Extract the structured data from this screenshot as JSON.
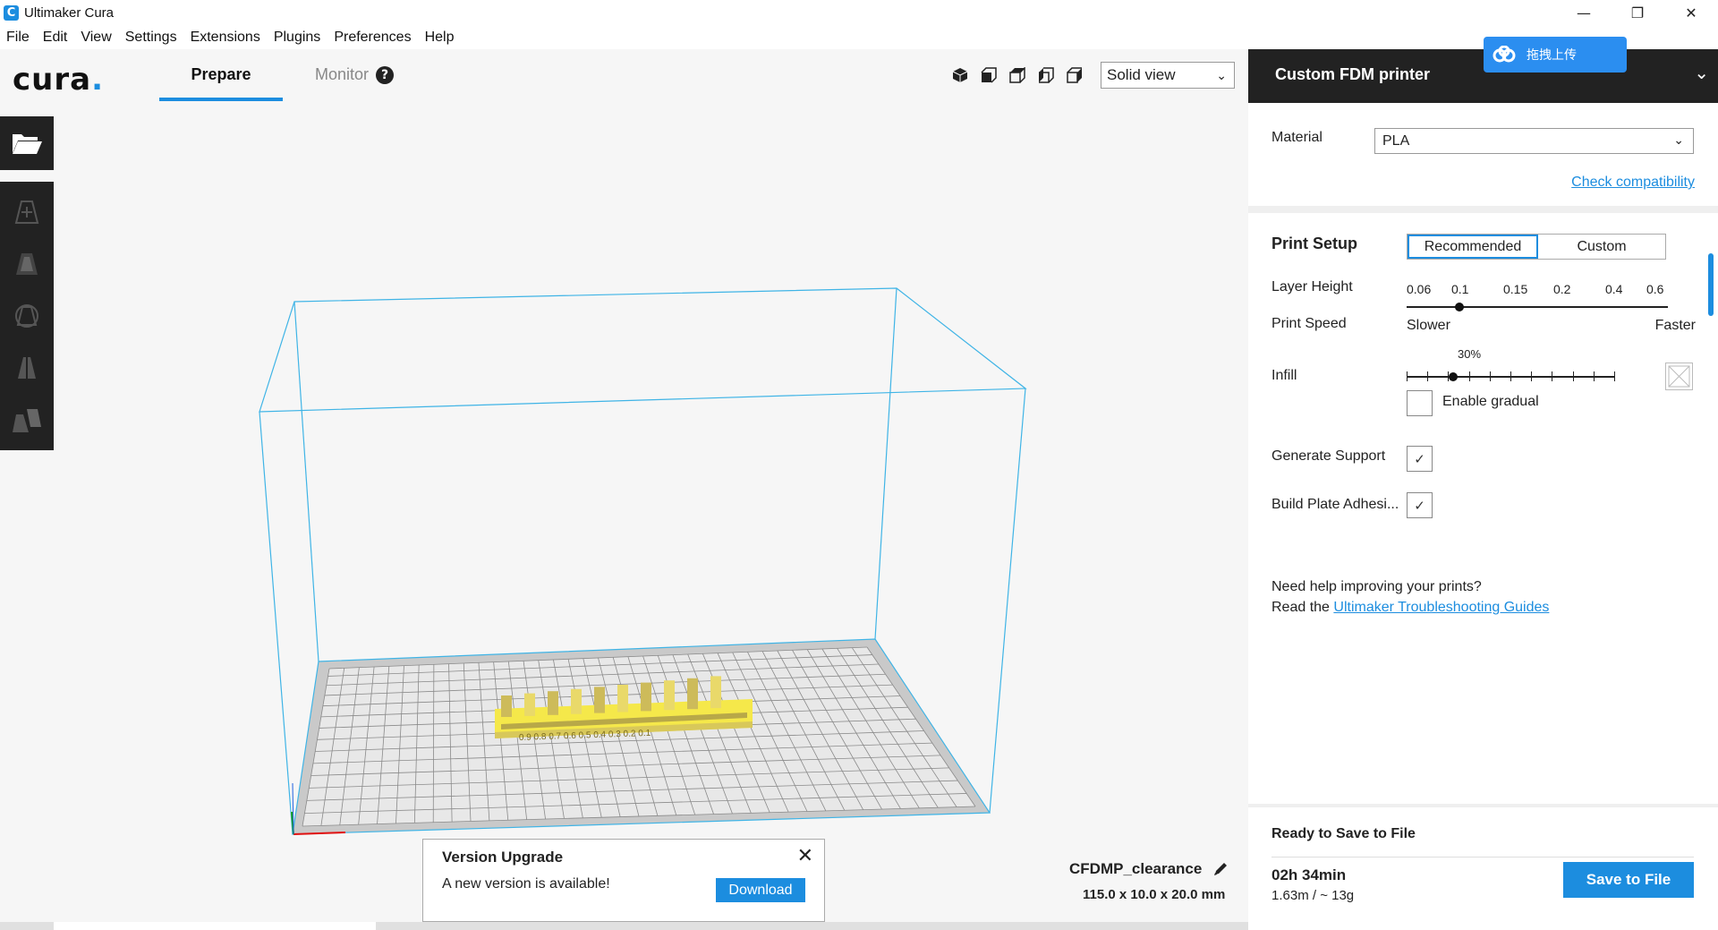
{
  "window": {
    "title": "Ultimaker Cura",
    "icon": "C",
    "minimize": "—",
    "restore": "❐",
    "close": "✕"
  },
  "menu": [
    "File",
    "Edit",
    "View",
    "Settings",
    "Extensions",
    "Plugins",
    "Preferences",
    "Help"
  ],
  "header": {
    "logo": "cura",
    "logo_dot": ".",
    "tabs": {
      "prepare": "Prepare",
      "monitor": "Monitor"
    },
    "monitor_help": "?",
    "view_select": "Solid view",
    "chevron": "⌄"
  },
  "notice": {
    "title": "Version Upgrade",
    "message": "A new version is available!",
    "download": "Download",
    "close": "✕"
  },
  "job": {
    "name": "CFDMP_clearance",
    "dimensions": "115.0 x 10.0 x 20.0 mm"
  },
  "model": {
    "labels": "0.9 0.8 0.7 0.6 0.5 0.4 0.3 0.2 0.1"
  },
  "sidebar": {
    "printer": "Custom FDM printer",
    "printer_chevron": "⌄",
    "cloud_label": "拖拽上传",
    "material_label": "Material",
    "material_value": "PLA",
    "check_compat": "Check compatibility",
    "print_setup": "Print Setup",
    "mode_recommended": "Recommended",
    "mode_custom": "Custom",
    "layer_height_label": "Layer Height",
    "layer_heights": [
      "0.06",
      "0.1",
      "0.15",
      "0.2",
      "0.4",
      "0.6"
    ],
    "layer_height_selected": "0.1",
    "print_speed_label": "Print Speed",
    "speed_slower": "Slower",
    "speed_faster": "Faster",
    "infill_label": "Infill",
    "infill_percent": "30%",
    "infill_fraction": 0.3,
    "enable_gradual": "Enable gradual",
    "enable_gradual_checked": false,
    "generate_support": "Generate Support",
    "generate_support_checked": true,
    "adhesion": "Build Plate Adhesi...",
    "adhesion_checked": true,
    "checkmark": "✓",
    "help_line1": "Need help improving your prints?",
    "help_line2_prefix": "Read the ",
    "help_link": "Ultimaker Troubleshooting Guides",
    "ready": "Ready to Save to File",
    "print_time": "02h 34min",
    "material_use": "1.63m / ~ 13g",
    "save_button": "Save to File"
  },
  "colors": {
    "accent": "#1c8ddf",
    "dark": "#222222",
    "model": "#f5e84a",
    "build_volume": "#3fb4e6"
  }
}
